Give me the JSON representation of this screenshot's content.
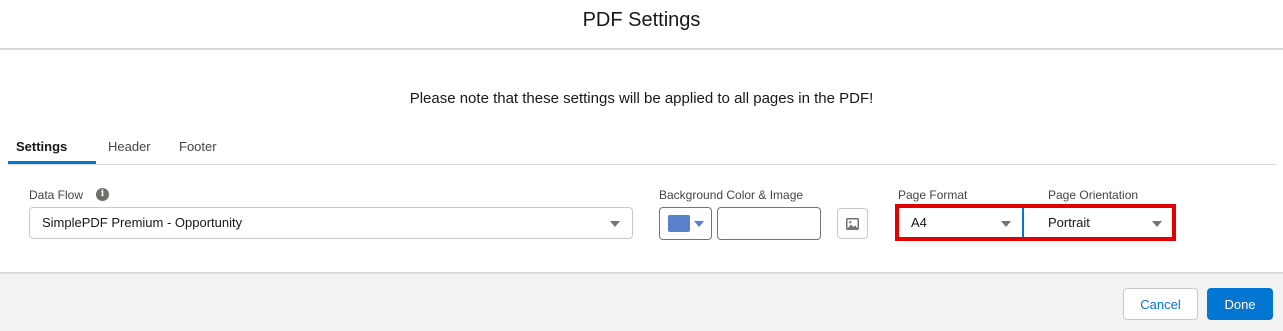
{
  "modal": {
    "title": "PDF Settings",
    "notice": "Please note that these settings will be applied to all pages in the PDF!"
  },
  "tabs": [
    {
      "label": "Settings",
      "active": true
    },
    {
      "label": "Header",
      "active": false
    },
    {
      "label": "Footer",
      "active": false
    }
  ],
  "fields": {
    "data_flow": {
      "label": "Data Flow",
      "value": "SimplePDF Premium - Opportunity",
      "info_icon": "info-icon"
    },
    "background": {
      "label": "Background Color & Image",
      "color": "#5a7fcb",
      "image_value": "",
      "image_icon": "image-icon"
    },
    "page_format": {
      "label": "Page Format",
      "value": "A4"
    },
    "page_orientation": {
      "label": "Page Orientation",
      "value": "Portrait"
    }
  },
  "footer": {
    "cancel_label": "Cancel",
    "done_label": "Done"
  },
  "colors": {
    "accent": "#0176d3",
    "highlight": "#e10000"
  }
}
